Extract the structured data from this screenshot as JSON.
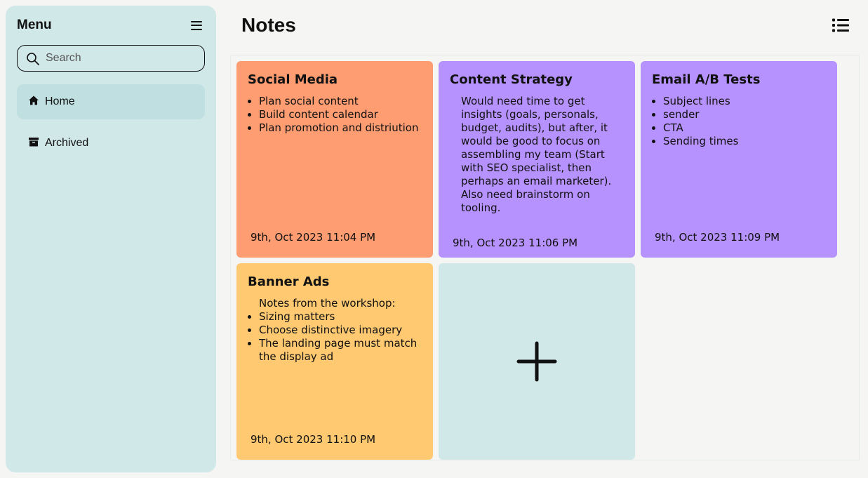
{
  "sidebar": {
    "title": "Menu",
    "search_placeholder": "Search",
    "items": [
      {
        "label": "Home",
        "icon": "home-icon",
        "active": true
      },
      {
        "label": "Archived",
        "icon": "archive-icon",
        "active": false
      }
    ]
  },
  "header": {
    "title": "Notes"
  },
  "notes": [
    {
      "title": "Social Media",
      "color": "#fe9c72",
      "bullets": [
        "Plan social content",
        "Build content calendar",
        "Plan promotion and distriution"
      ],
      "date": "9th, Oct 2023 11:04 PM"
    },
    {
      "title": "Content Strategy",
      "color": "#b692fe",
      "text": "Would need time to get insights (goals, personals, budget, audits), but after, it would be good to focus on assembling my team (Start with SEO specialist, then perhaps an email marketer). Also need brainstorm on tooling.",
      "date": "9th, Oct 2023 11:06 PM"
    },
    {
      "title": "Email A/B Tests",
      "color": "#b692fe",
      "bullets": [
        "Subject lines",
        "sender",
        "CTA",
        "Sending times"
      ],
      "date": "9th, Oct 2023 11:09 PM"
    },
    {
      "title": "Banner Ads",
      "color": "#ffc972",
      "intro": "Notes from the workshop:",
      "bullets": [
        "Sizing matters",
        "Choose distinctive imagery",
        "The landing page must match the display ad"
      ],
      "date": "9th, Oct 2023 11:10 PM"
    }
  ],
  "add_card": {
    "icon": "plus-icon"
  },
  "colors": {
    "sidebar_bg": "#d1e8e8",
    "active_item": "#c0dfe0",
    "page_bg": "#f5f5f3"
  }
}
